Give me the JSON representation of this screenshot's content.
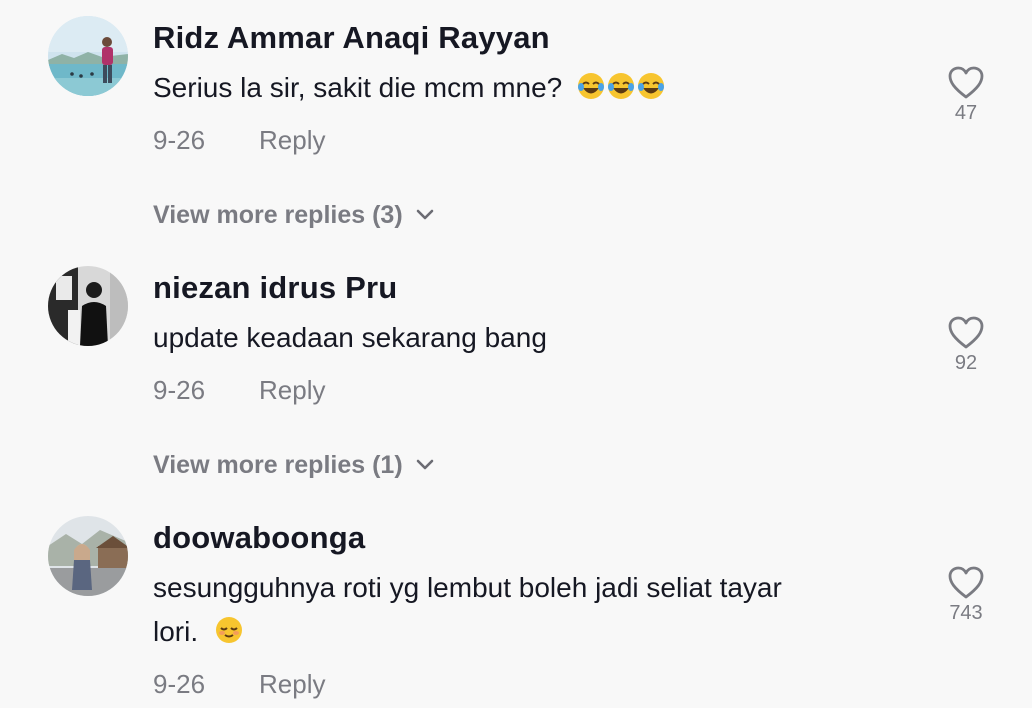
{
  "comments": [
    {
      "username": "Ridz Ammar Anaqi Rayyan",
      "text": "Serius la sir, sakit die mcm mne?",
      "emoji_icons": [
        "face-with-tears-of-joy",
        "face-with-tears-of-joy",
        "face-with-tears-of-joy"
      ],
      "date": "9-26",
      "reply_label": "Reply",
      "likes": "47",
      "view_more": "View more replies (3)"
    },
    {
      "username": "niezan idrus Pru",
      "text": "update keadaan sekarang bang",
      "date": "9-26",
      "reply_label": "Reply",
      "likes": "92",
      "view_more": "View more replies (1)"
    },
    {
      "username": "doowaboonga",
      "text_line1": "sesungguhnya roti yg lembut boleh jadi seliat tayar",
      "text_line2": "lori.",
      "emoji_icons": [
        "relieved-face"
      ],
      "date": "9-26",
      "reply_label": "Reply",
      "likes": "743"
    }
  ],
  "icons": {
    "like": "heart-outline-icon",
    "expand": "chevron-down-icon"
  },
  "colors": {
    "background": "#f8f8f8",
    "primary_text": "#161823",
    "secondary_text": "#7a7b82"
  }
}
